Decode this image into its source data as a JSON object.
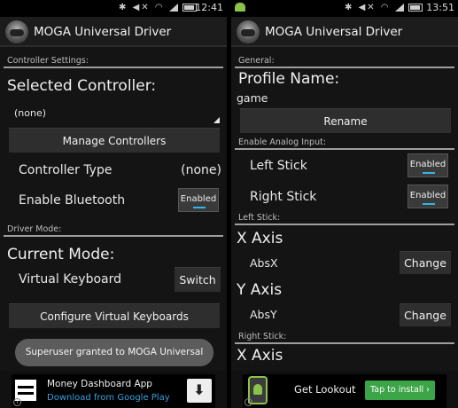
{
  "left": {
    "status": {
      "time": "12:41",
      "icons": [
        "bluetooth-icon",
        "mute-icon",
        "wifi-icon",
        "signal-icon",
        "battery-icon"
      ]
    },
    "app_title": "MOGA Universal Driver",
    "controller_settings": {
      "header": "Controller Settings:",
      "selected_label": "Selected Controller:",
      "selected_value": "(none)",
      "manage_button": "Manage Controllers",
      "type_label": "Controller Type",
      "type_value": "(none)",
      "bluetooth_label": "Enable Bluetooth",
      "bluetooth_toggle": "Enabled"
    },
    "driver_mode": {
      "header": "Driver Mode:",
      "current_label": "Current Mode:",
      "mode_value": "Virtual Keyboard",
      "switch_button": "Switch",
      "configure_button": "Configure Virtual Keyboards"
    },
    "toast": "Superuser granted to MOGA Universal Driver",
    "ad": {
      "title": "Money Dashboard App",
      "subtitle": "Download from Google Play",
      "download_icon": "download-arrow-icon"
    }
  },
  "right": {
    "status": {
      "time": "13:51",
      "icons": [
        "android-icon",
        "bluetooth-icon",
        "mute-icon",
        "wifi-icon",
        "signal-icon",
        "battery-icon"
      ]
    },
    "app_title": "MOGA Universal Driver",
    "general": {
      "header": "General:",
      "profile_label": "Profile Name:",
      "profile_value": "game",
      "rename_button": "Rename"
    },
    "analog": {
      "header": "Enable Analog Input:",
      "left_stick_label": "Left Stick",
      "left_stick_toggle": "Enabled",
      "right_stick_label": "Right Stick",
      "right_stick_toggle": "Enabled"
    },
    "left_stick": {
      "header": "Left Stick:",
      "x_label": "X Axis",
      "x_value": "AbsX",
      "x_change": "Change",
      "y_label": "Y Axis",
      "y_value": "AbsY",
      "y_change": "Change"
    },
    "right_stick": {
      "header": "Right Stick:",
      "x_label": "X Axis"
    },
    "ad": {
      "title": "Get Lookout",
      "install": "Tap to install ›"
    }
  },
  "colors": {
    "accent": "#33b5e5",
    "background": "#141414",
    "ad_green": "#3ca547"
  }
}
